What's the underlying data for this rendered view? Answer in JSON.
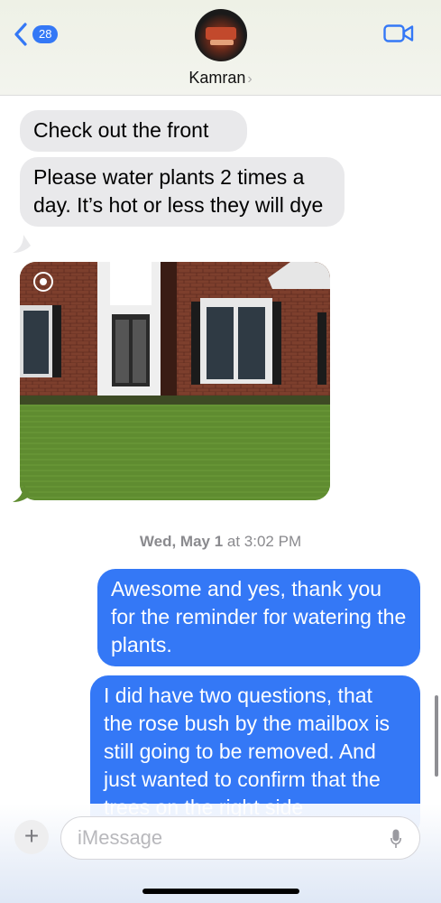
{
  "header": {
    "back_count": "28",
    "contact_name": "Kamran",
    "contact_chevron": "›",
    "icons": {
      "back": "chevron-left-icon",
      "video": "video-camera-icon"
    }
  },
  "messages": {
    "incoming": [
      {
        "text": "Check out the front"
      },
      {
        "text": "Please water plants 2 times a day. It’s hot or less they will dye"
      }
    ],
    "photo": {
      "alt": "House front with lawn"
    },
    "timestamp_day": "Wed, May 1",
    "timestamp_at": " at ",
    "timestamp_time": "3:02 PM",
    "outgoing": [
      {
        "text": "Awesome and yes, thank you for the reminder for watering the plants."
      },
      {
        "text": "I did have two questions, that the rose bush by the mailbox is still going to be removed. And just wanted to confirm that the trees on the right side"
      }
    ]
  },
  "composer": {
    "plus_label": "+",
    "placeholder": "iMessage",
    "icons": {
      "plus": "plus-icon",
      "mic": "microphone-icon"
    }
  },
  "colors": {
    "accent": "#3478f6",
    "incoming_bubble": "#e9e9eb",
    "header_bg": "#eef1e6"
  }
}
